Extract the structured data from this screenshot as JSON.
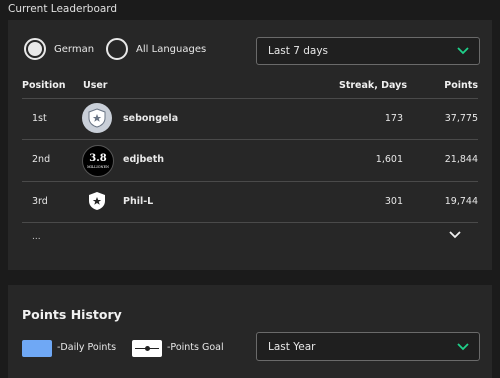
{
  "page": {
    "title": "Current Leaderboard"
  },
  "leaderboard": {
    "filters": [
      {
        "label": "German",
        "selected": true
      },
      {
        "label": "All Languages",
        "selected": false
      }
    ],
    "period": {
      "value": "Last 7 days",
      "icon": "chevron-down-icon"
    },
    "columns": {
      "position": "Position",
      "user": "User",
      "streak": "Streak, Days",
      "points": "Points"
    },
    "rows": [
      {
        "position": "1st",
        "user": "sebongela",
        "streak": "173",
        "points": "37,775",
        "avatar": "shield-star-avatar"
      },
      {
        "position": "2nd",
        "user": "edjbeth",
        "streak": "1,601",
        "points": "21,844",
        "avatar": "millionen-badge-avatar"
      },
      {
        "position": "3rd",
        "user": "Phil-L",
        "streak": "301",
        "points": "19,744",
        "avatar": "shield-star-avatar"
      }
    ],
    "more": "...",
    "expand_icon": "chevron-down-icon",
    "avatar_badge": {
      "top": "3.8",
      "bottom": "MILLIONEN"
    }
  },
  "points_history": {
    "title": "Points History",
    "legend": [
      {
        "label": "-Daily Points",
        "color": "#6fa8f5"
      },
      {
        "label": "-Points Goal",
        "color": "#ffffff"
      }
    ],
    "range": {
      "value": "Last Year",
      "icon": "chevron-down-icon"
    }
  },
  "colors": {
    "background": "#1b1b1b",
    "card": "#272727",
    "accent": "#1fd18a"
  }
}
